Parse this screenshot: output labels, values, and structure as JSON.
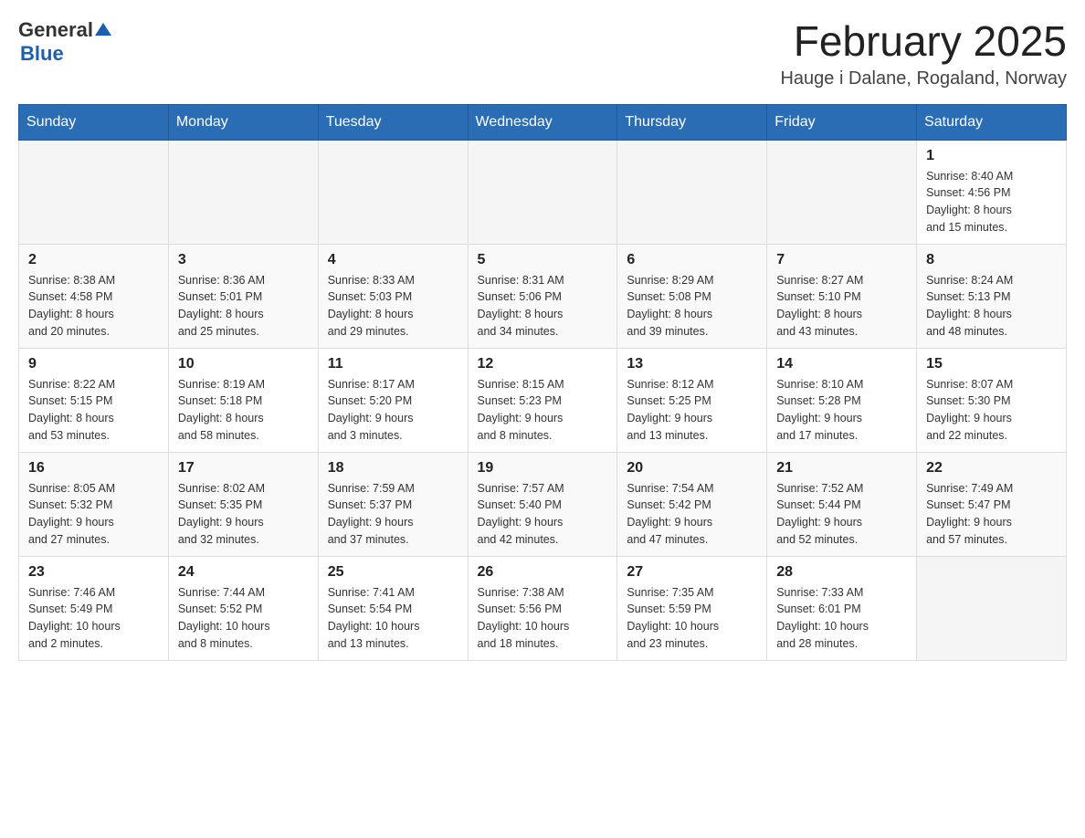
{
  "header": {
    "logo": {
      "general": "General",
      "blue": "Blue"
    },
    "title": "February 2025",
    "location": "Hauge i Dalane, Rogaland, Norway"
  },
  "weekdays": [
    "Sunday",
    "Monday",
    "Tuesday",
    "Wednesday",
    "Thursday",
    "Friday",
    "Saturday"
  ],
  "weeks": [
    [
      {
        "day": "",
        "info": ""
      },
      {
        "day": "",
        "info": ""
      },
      {
        "day": "",
        "info": ""
      },
      {
        "day": "",
        "info": ""
      },
      {
        "day": "",
        "info": ""
      },
      {
        "day": "",
        "info": ""
      },
      {
        "day": "1",
        "info": "Sunrise: 8:40 AM\nSunset: 4:56 PM\nDaylight: 8 hours\nand 15 minutes."
      }
    ],
    [
      {
        "day": "2",
        "info": "Sunrise: 8:38 AM\nSunset: 4:58 PM\nDaylight: 8 hours\nand 20 minutes."
      },
      {
        "day": "3",
        "info": "Sunrise: 8:36 AM\nSunset: 5:01 PM\nDaylight: 8 hours\nand 25 minutes."
      },
      {
        "day": "4",
        "info": "Sunrise: 8:33 AM\nSunset: 5:03 PM\nDaylight: 8 hours\nand 29 minutes."
      },
      {
        "day": "5",
        "info": "Sunrise: 8:31 AM\nSunset: 5:06 PM\nDaylight: 8 hours\nand 34 minutes."
      },
      {
        "day": "6",
        "info": "Sunrise: 8:29 AM\nSunset: 5:08 PM\nDaylight: 8 hours\nand 39 minutes."
      },
      {
        "day": "7",
        "info": "Sunrise: 8:27 AM\nSunset: 5:10 PM\nDaylight: 8 hours\nand 43 minutes."
      },
      {
        "day": "8",
        "info": "Sunrise: 8:24 AM\nSunset: 5:13 PM\nDaylight: 8 hours\nand 48 minutes."
      }
    ],
    [
      {
        "day": "9",
        "info": "Sunrise: 8:22 AM\nSunset: 5:15 PM\nDaylight: 8 hours\nand 53 minutes."
      },
      {
        "day": "10",
        "info": "Sunrise: 8:19 AM\nSunset: 5:18 PM\nDaylight: 8 hours\nand 58 minutes."
      },
      {
        "day": "11",
        "info": "Sunrise: 8:17 AM\nSunset: 5:20 PM\nDaylight: 9 hours\nand 3 minutes."
      },
      {
        "day": "12",
        "info": "Sunrise: 8:15 AM\nSunset: 5:23 PM\nDaylight: 9 hours\nand 8 minutes."
      },
      {
        "day": "13",
        "info": "Sunrise: 8:12 AM\nSunset: 5:25 PM\nDaylight: 9 hours\nand 13 minutes."
      },
      {
        "day": "14",
        "info": "Sunrise: 8:10 AM\nSunset: 5:28 PM\nDaylight: 9 hours\nand 17 minutes."
      },
      {
        "day": "15",
        "info": "Sunrise: 8:07 AM\nSunset: 5:30 PM\nDaylight: 9 hours\nand 22 minutes."
      }
    ],
    [
      {
        "day": "16",
        "info": "Sunrise: 8:05 AM\nSunset: 5:32 PM\nDaylight: 9 hours\nand 27 minutes."
      },
      {
        "day": "17",
        "info": "Sunrise: 8:02 AM\nSunset: 5:35 PM\nDaylight: 9 hours\nand 32 minutes."
      },
      {
        "day": "18",
        "info": "Sunrise: 7:59 AM\nSunset: 5:37 PM\nDaylight: 9 hours\nand 37 minutes."
      },
      {
        "day": "19",
        "info": "Sunrise: 7:57 AM\nSunset: 5:40 PM\nDaylight: 9 hours\nand 42 minutes."
      },
      {
        "day": "20",
        "info": "Sunrise: 7:54 AM\nSunset: 5:42 PM\nDaylight: 9 hours\nand 47 minutes."
      },
      {
        "day": "21",
        "info": "Sunrise: 7:52 AM\nSunset: 5:44 PM\nDaylight: 9 hours\nand 52 minutes."
      },
      {
        "day": "22",
        "info": "Sunrise: 7:49 AM\nSunset: 5:47 PM\nDaylight: 9 hours\nand 57 minutes."
      }
    ],
    [
      {
        "day": "23",
        "info": "Sunrise: 7:46 AM\nSunset: 5:49 PM\nDaylight: 10 hours\nand 2 minutes."
      },
      {
        "day": "24",
        "info": "Sunrise: 7:44 AM\nSunset: 5:52 PM\nDaylight: 10 hours\nand 8 minutes."
      },
      {
        "day": "25",
        "info": "Sunrise: 7:41 AM\nSunset: 5:54 PM\nDaylight: 10 hours\nand 13 minutes."
      },
      {
        "day": "26",
        "info": "Sunrise: 7:38 AM\nSunset: 5:56 PM\nDaylight: 10 hours\nand 18 minutes."
      },
      {
        "day": "27",
        "info": "Sunrise: 7:35 AM\nSunset: 5:59 PM\nDaylight: 10 hours\nand 23 minutes."
      },
      {
        "day": "28",
        "info": "Sunrise: 7:33 AM\nSunset: 6:01 PM\nDaylight: 10 hours\nand 28 minutes."
      },
      {
        "day": "",
        "info": ""
      }
    ]
  ]
}
